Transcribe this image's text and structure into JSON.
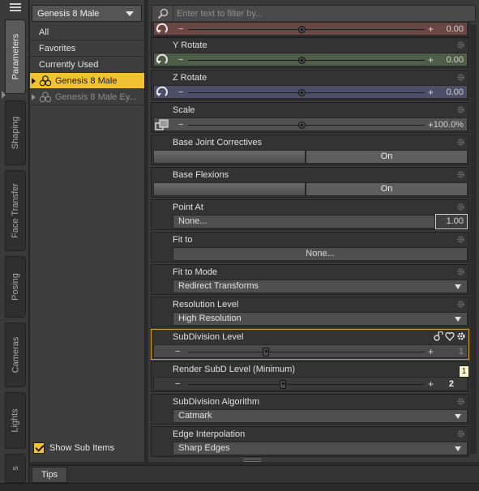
{
  "tabs": {
    "vertical": [
      {
        "label": "Parameters",
        "active": true
      },
      {
        "label": "Shaping",
        "active": false
      },
      {
        "label": "Face Transfer",
        "active": false
      },
      {
        "label": "Posing",
        "active": false
      },
      {
        "label": "Cameras",
        "active": false
      },
      {
        "label": "Lights",
        "active": false
      },
      {
        "label": "s",
        "active": false
      }
    ]
  },
  "nodes": {
    "selected_node": "Genesis 8 Male",
    "items": [
      {
        "label": "All"
      },
      {
        "label": "Favorites"
      },
      {
        "label": "Currently Used"
      },
      {
        "label": "Genesis 8 Male",
        "state": "selected"
      },
      {
        "label": "Genesis 8 Male Ey...",
        "state": "dim"
      }
    ],
    "show_sub_items": "Show Sub Items"
  },
  "filter": {
    "placeholder": "Enter text to filter by..."
  },
  "params": [
    {
      "label": "",
      "value": "0.00",
      "fill": 0.48
    },
    {
      "label": "Y Rotate",
      "value": "0.00",
      "fill": 0.48
    },
    {
      "label": "Z Rotate",
      "value": "0.00",
      "fill": 0.48
    },
    {
      "label": "Scale",
      "value": "100.0%",
      "fill": 0.48
    },
    {
      "label": "Base Joint Correctives",
      "value": "On"
    },
    {
      "label": "Base Flexions",
      "value": "On"
    },
    {
      "label": "Point At",
      "value": "None...",
      "number": "1.00"
    },
    {
      "label": "Fit to",
      "value": "None..."
    },
    {
      "label": "Fit to Mode",
      "value": "Redirect Transforms"
    },
    {
      "label": "Resolution Level",
      "value": "High Resolution"
    },
    {
      "label": "SubDivision Level",
      "value": "1",
      "fill": 0.33
    },
    {
      "label": "Render SubD Level (Minimum)",
      "value": "2",
      "fill": 0.4
    },
    {
      "label": "SubDivision Algorithm",
      "value": "Catmark"
    },
    {
      "label": "Edge Interpolation",
      "value": "Sharp Edges"
    }
  ],
  "tooltip": "1",
  "bottom": {
    "tips_tab": "Tips"
  },
  "colors": {
    "accent": "#f2c233",
    "highlight_border": "#c9a02a"
  }
}
